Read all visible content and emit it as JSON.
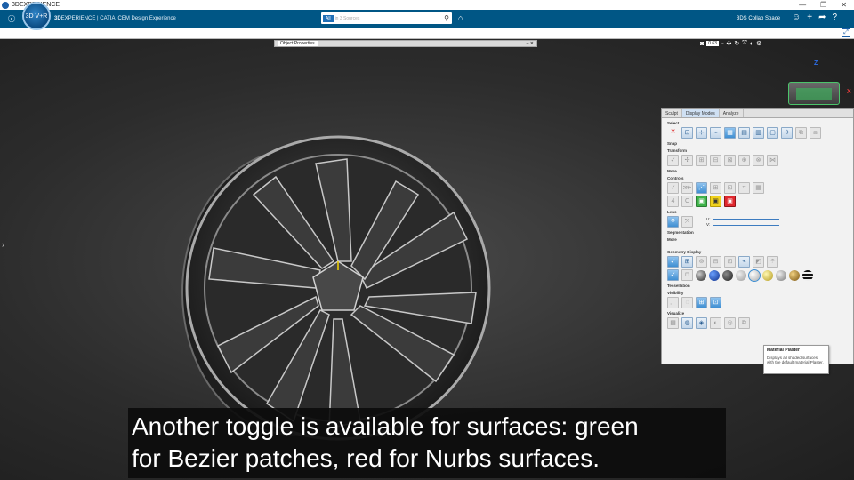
{
  "os_bar": {
    "title": "3DEXPERIENCE",
    "controls": [
      "—",
      "❐",
      "✕"
    ]
  },
  "app_bar": {
    "brand_prefix": "3D",
    "brand_main": "EXPERIENCE | CATIA",
    "brand_app": "ICEM Design Experience",
    "compass_label": "3D V+R",
    "search": {
      "scope": "All",
      "placeholder": "in 3 Sources"
    },
    "collab_space": "3DS Collab Space",
    "icons": [
      "user-icon",
      "plus-icon",
      "share-icon",
      "help-icon"
    ]
  },
  "viewport": {
    "object_properties_title": "Object Properties",
    "zoom_value": "0.63",
    "axis_z": "Z",
    "axis_x": "X"
  },
  "panel": {
    "tabs": [
      "Sculpt",
      "Display Modes",
      "Analyze"
    ],
    "sections": {
      "select": "Select",
      "snap": "Snap",
      "transform": "Transform",
      "more1": "More",
      "controls": "Controls",
      "controls_num1": "4",
      "controls_num2": "C",
      "lens": "Lens",
      "lens_u": "U:",
      "lens_v": "V:",
      "segmentation": "Segmentation",
      "more2": "More",
      "geometry_display": "Geometry Display",
      "tessellation": "Tessellation",
      "visibility": "Visibility",
      "visualize": "Visualize"
    },
    "colors": {
      "green": "#3fb34a",
      "yellow": "#f1d21c",
      "red": "#e0282e",
      "accent": "#005685"
    }
  },
  "tooltip": {
    "title": "Material Plaster",
    "body": "Displays all shaded surfaces with the default material Plaster."
  },
  "caption": {
    "line1": "Another toggle is available for surfaces:  green",
    "line2": "for Bezier patches, red for Nurbs surfaces."
  }
}
